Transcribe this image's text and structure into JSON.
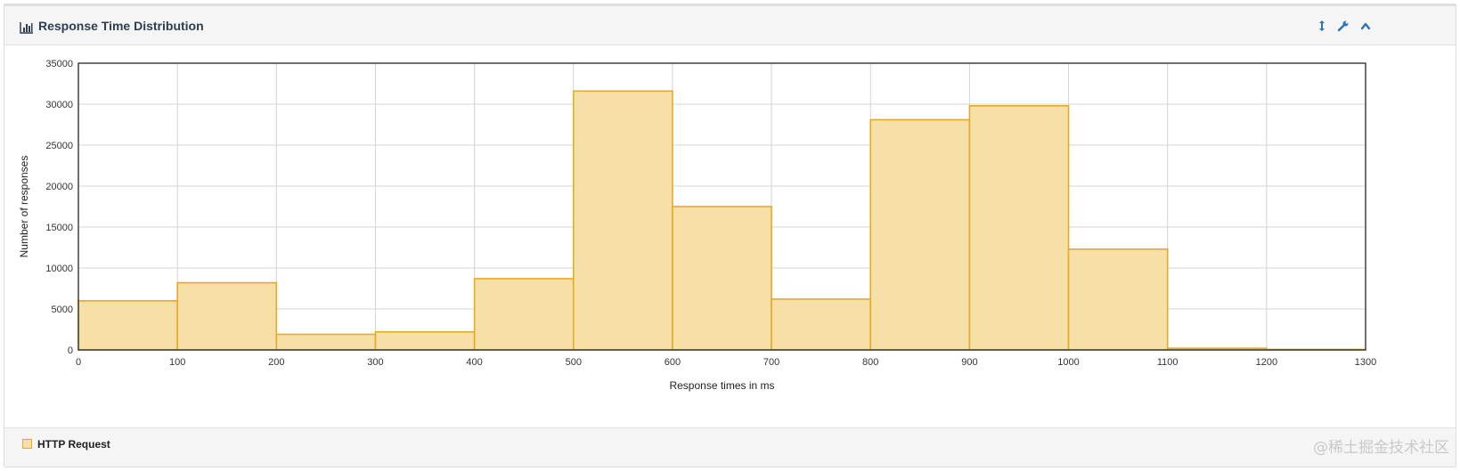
{
  "panel": {
    "title": "Response Time Distribution",
    "header_icon": "bar-chart-icon",
    "tools": [
      {
        "name": "resize-vertical-icon"
      },
      {
        "name": "wrench-icon"
      },
      {
        "name": "chevron-up-icon"
      }
    ],
    "accent_color": "#2a73b8"
  },
  "chart_data": {
    "type": "bar",
    "title": "",
    "xlabel": "Response times in ms",
    "ylabel": "Number of responses",
    "xlim": [
      0,
      1300
    ],
    "ylim": [
      0,
      35000
    ],
    "x_ticks": [
      0,
      100,
      200,
      300,
      400,
      500,
      600,
      700,
      800,
      900,
      1000,
      1100,
      1200,
      1300
    ],
    "y_ticks": [
      0,
      5000,
      10000,
      15000,
      20000,
      25000,
      30000,
      35000
    ],
    "grid": true,
    "bin_width": 100,
    "series": [
      {
        "name": "HTTP Request",
        "color": "#e8a925",
        "fill": "#f6e0a8",
        "bins": [
          0,
          100,
          200,
          300,
          400,
          500,
          600,
          700,
          800,
          900,
          1000,
          1100,
          1200
        ],
        "values": [
          6000,
          8200,
          1900,
          2200,
          8700,
          31600,
          17500,
          6200,
          28100,
          29800,
          12300,
          200,
          60
        ]
      }
    ]
  },
  "legend": {
    "items": [
      {
        "label": "HTTP Request",
        "color": "#e8a925"
      }
    ]
  },
  "watermark": "@稀土掘金技术社区"
}
